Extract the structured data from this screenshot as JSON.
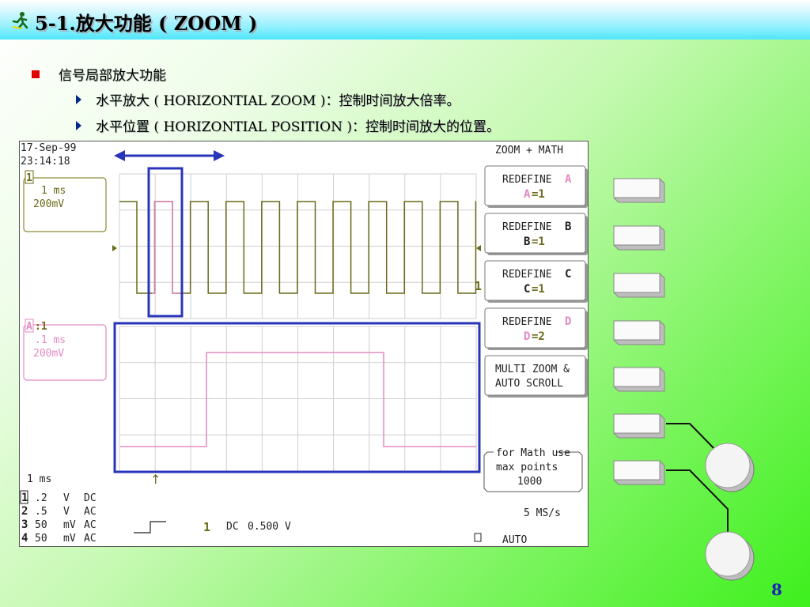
{
  "slide": {
    "title": "5-1.放大功能 ( ZOOM )",
    "bullet": "信号局部放大功能",
    "sub1": "水平放大 ( HORIZONTIAL ZOOM )：控制时间放大倍率。",
    "sub2": "水平位置 ( HORIZONTIAL POSITION )：控制时间放大的位置。",
    "page_number": "8"
  },
  "scope": {
    "date": "17-Sep-99",
    "time": "23:14:18",
    "mode_header": "ZOOM + MATH",
    "ch1": {
      "badge": "1",
      "timebase": "1 ms",
      "volts": "200mV",
      "trace_marker": "1"
    },
    "za": {
      "badge": "A",
      "suffix": ":1",
      "timebase": ".1 ms",
      "volts": "200mV"
    },
    "redefine": [
      {
        "label": "REDEFINE",
        "letter": "A",
        "assign": "A",
        "value": "=1"
      },
      {
        "label": "REDEFINE",
        "letter": "B",
        "assign": "B",
        "value": "=1"
      },
      {
        "label": "REDEFINE",
        "letter": "C",
        "assign": "C",
        "value": "=1"
      },
      {
        "label": "REDEFINE",
        "letter": "D",
        "assign": "D",
        "value": "=2"
      }
    ],
    "multizoom": {
      "line1": "MULTI ZOOM &",
      "line2": "AUTO SCROLL"
    },
    "math_note": {
      "line1": "for Math use",
      "line2": "max points",
      "line3": "1000"
    },
    "timebase_bottom": "1 ms",
    "channels": [
      {
        "num": "1",
        "volts": ".2",
        "unit": "V",
        "coupling": "DC"
      },
      {
        "num": "2",
        "volts": ".5",
        "unit": "V",
        "coupling": "AC"
      },
      {
        "num": "3",
        "volts": "50",
        "unit": "mV",
        "coupling": "AC"
      },
      {
        "num": "4",
        "volts": "50",
        "unit": "mV",
        "coupling": "AC"
      }
    ],
    "trigger": {
      "source": "1",
      "coupling": "DC",
      "level": "0.500 V"
    },
    "sample_rate": "5 MS/s",
    "trigger_mode": "AUTO",
    "arrow_label": "↑"
  },
  "colors": {
    "title_blue": "#1a22b5",
    "ch1_olive": "#6b6a1a",
    "zoom_pink": "#e48ac0",
    "annotation_blue": "#2a34b8",
    "bullet_red": "#e00000"
  }
}
